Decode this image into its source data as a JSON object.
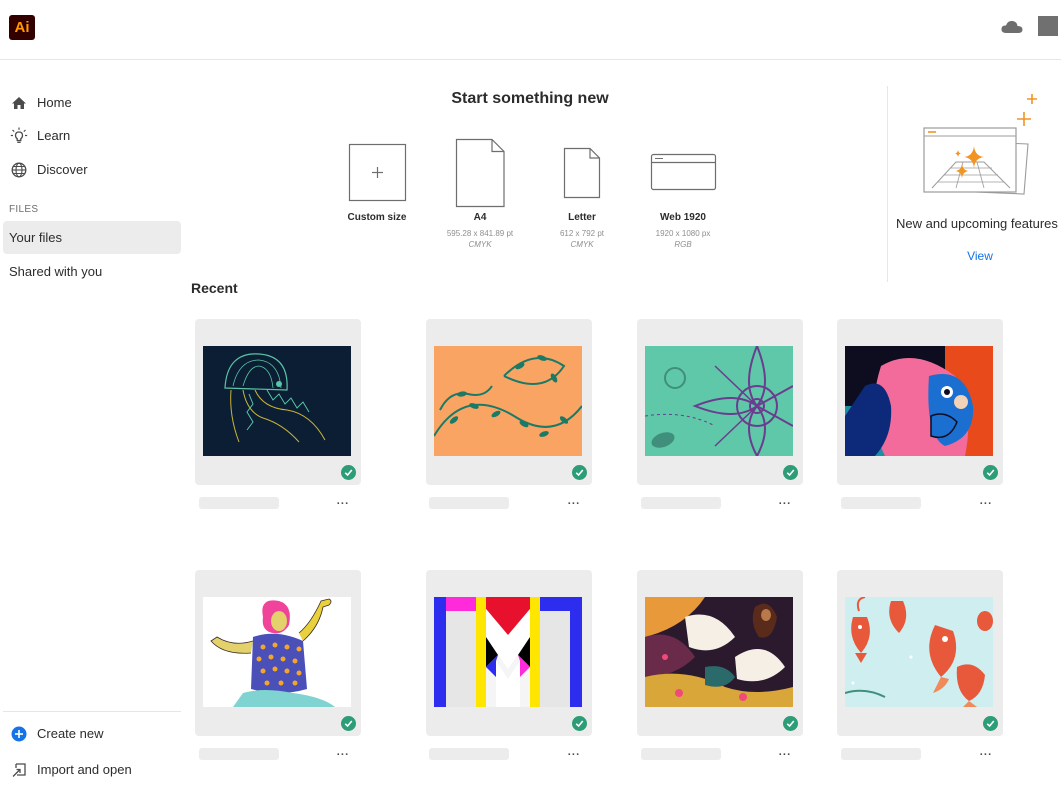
{
  "app": {
    "logo_text": "Ai"
  },
  "sidebar": {
    "items": [
      {
        "label": "Home",
        "icon": "home-icon"
      },
      {
        "label": "Learn",
        "icon": "lightbulb-icon"
      },
      {
        "label": "Discover",
        "icon": "globe-icon"
      }
    ],
    "files_section_label": "FILES",
    "file_items": [
      {
        "label": "Your files",
        "selected": true
      },
      {
        "label": "Shared with you",
        "selected": false
      }
    ],
    "bottom_items": [
      {
        "label": "Create new",
        "icon": "plus-circle-icon",
        "icon_color": "#1473e6"
      },
      {
        "label": "Import and open",
        "icon": "import-icon"
      }
    ]
  },
  "start": {
    "title": "Start something new",
    "presets": [
      {
        "name": "Custom size",
        "dimensions": "",
        "mode": ""
      },
      {
        "name": "A4",
        "dimensions": "595.28 x 841.89 pt",
        "mode": "CMYK"
      },
      {
        "name": "Letter",
        "dimensions": "612 x 792 pt",
        "mode": "CMYK"
      },
      {
        "name": "Web 1920",
        "dimensions": "1920 x 1080 px",
        "mode": "RGB"
      }
    ]
  },
  "features": {
    "title": "New and upcoming features",
    "link_label": "View",
    "accent_color": "#f29423"
  },
  "recent": {
    "title": "Recent",
    "files": [
      {
        "thumbnail": "jellyfish-illustration",
        "synced": true,
        "more_label": "···"
      },
      {
        "thumbnail": "orange-vine-illustration",
        "synced": true,
        "more_label": "···"
      },
      {
        "thumbnail": "teal-geometric-flower",
        "synced": true,
        "more_label": "···"
      },
      {
        "thumbnail": "pink-face-illustration",
        "synced": true,
        "more_label": "···"
      },
      {
        "thumbnail": "dancing-woman-illustration",
        "synced": true,
        "more_label": "···"
      },
      {
        "thumbnail": "colorful-letter-m",
        "synced": true,
        "more_label": "···"
      },
      {
        "thumbnail": "swans-woman-illustration",
        "synced": true,
        "more_label": "···"
      },
      {
        "thumbnail": "koi-fish-illustration",
        "synced": true,
        "more_label": "···"
      }
    ]
  },
  "colors": {
    "accent_blue": "#1473e6",
    "sync_green": "#2d9d78",
    "logo_bg": "#330000",
    "logo_fg": "#ff9a00"
  }
}
